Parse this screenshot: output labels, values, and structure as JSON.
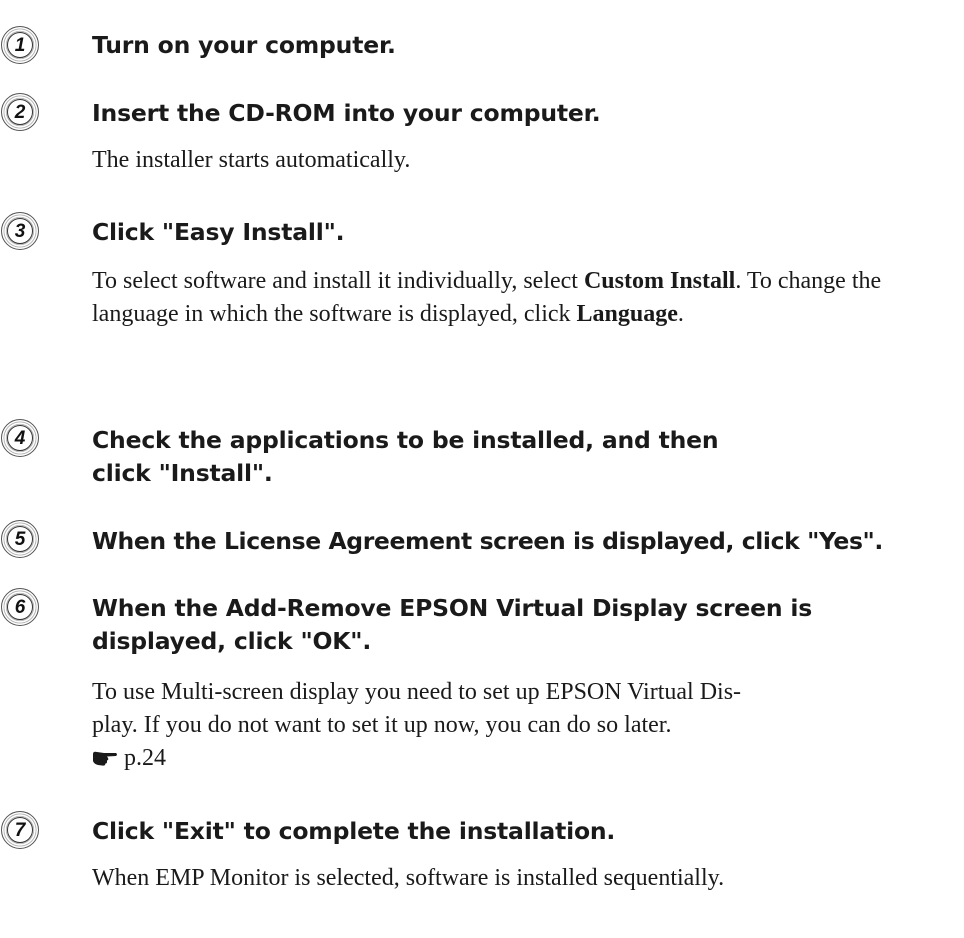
{
  "steps": [
    {
      "number": "1",
      "heading": "Turn on your computer."
    },
    {
      "number": "2",
      "heading": "Insert the CD-ROM into your computer.",
      "body": "The installer starts automatically."
    },
    {
      "number": "3",
      "heading": "Click \"Easy Install\".",
      "body_parts": {
        "pre": "To select software and install it individually, select ",
        "bold1": "Custom Install",
        "mid": ". To change the language in which the software is displayed, click ",
        "bold2": "Language",
        "post": "."
      }
    },
    {
      "number": "4",
      "heading": "Check the applications to be installed, and then click \"Install\"."
    },
    {
      "number": "5",
      "heading": "When the License Agreement screen is displayed, click \"Yes\"."
    },
    {
      "number": "6",
      "heading": "When the Add-Remove EPSON Virtual Display screen is displayed, click \"OK\".",
      "body_line1": "To use Multi-screen display you need to set up EPSON Virtual Dis-",
      "body_line2": "play. If you do not want to set it up now, you can do so later.",
      "reference": "p.24",
      "reference_icon": "pointing-hand-icon"
    },
    {
      "number": "7",
      "heading": "Click \"Exit\" to complete the installation.",
      "body": "When EMP Monitor is selected, software is installed sequentially."
    }
  ]
}
